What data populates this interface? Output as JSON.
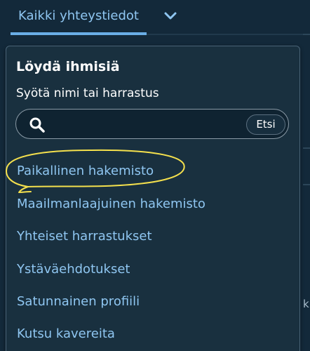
{
  "tabs": {
    "active_label": "Kaikki yhteystiedot",
    "dropdown_icon": "chevron-down-icon"
  },
  "edge": {
    "partial_char": "ki"
  },
  "panel": {
    "title": "Löydä ihmisiä",
    "subtitle": "Syötä nimi tai harrastus",
    "search": {
      "value": "",
      "placeholder": "",
      "icon": "search-icon",
      "button_label": "Etsi"
    },
    "menu": [
      {
        "label": "Paikallinen hakemisto"
      },
      {
        "label": "Maailmanlaajuinen hakemisto"
      },
      {
        "label": "Yhteiset harrastukset"
      },
      {
        "label": "Ystäväehdotukset"
      },
      {
        "label": "Satunnainen profiili"
      },
      {
        "label": "Kutsu kavereita"
      }
    ]
  },
  "colors": {
    "background": "#13293a",
    "panel": "#19303f",
    "link": "#8fc6f1",
    "tab_underline": "#6aaee6",
    "annotation": "#f4e04d"
  }
}
